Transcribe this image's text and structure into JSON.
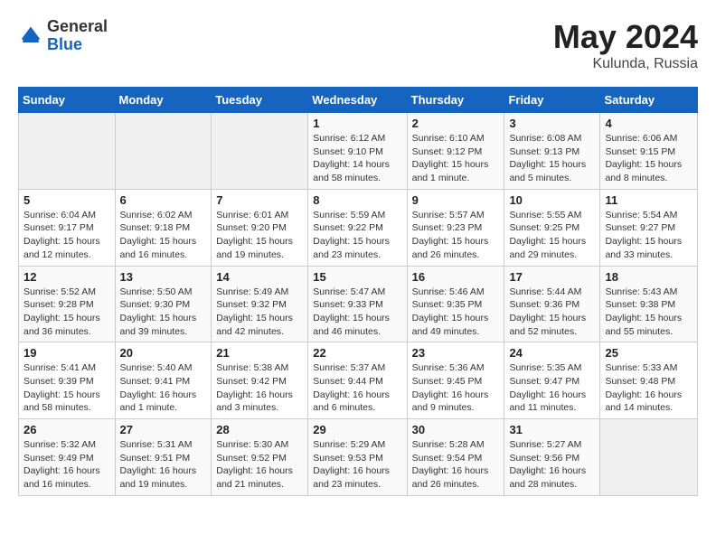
{
  "header": {
    "logo": {
      "general": "General",
      "blue": "Blue"
    },
    "title": "May 2024",
    "location": "Kulunda, Russia"
  },
  "weekdays": [
    "Sunday",
    "Monday",
    "Tuesday",
    "Wednesday",
    "Thursday",
    "Friday",
    "Saturday"
  ],
  "weeks": [
    [
      {
        "day": "",
        "info": ""
      },
      {
        "day": "",
        "info": ""
      },
      {
        "day": "",
        "info": ""
      },
      {
        "day": "1",
        "info": "Sunrise: 6:12 AM\nSunset: 9:10 PM\nDaylight: 14 hours\nand 58 minutes."
      },
      {
        "day": "2",
        "info": "Sunrise: 6:10 AM\nSunset: 9:12 PM\nDaylight: 15 hours\nand 1 minute."
      },
      {
        "day": "3",
        "info": "Sunrise: 6:08 AM\nSunset: 9:13 PM\nDaylight: 15 hours\nand 5 minutes."
      },
      {
        "day": "4",
        "info": "Sunrise: 6:06 AM\nSunset: 9:15 PM\nDaylight: 15 hours\nand 8 minutes."
      }
    ],
    [
      {
        "day": "5",
        "info": "Sunrise: 6:04 AM\nSunset: 9:17 PM\nDaylight: 15 hours\nand 12 minutes."
      },
      {
        "day": "6",
        "info": "Sunrise: 6:02 AM\nSunset: 9:18 PM\nDaylight: 15 hours\nand 16 minutes."
      },
      {
        "day": "7",
        "info": "Sunrise: 6:01 AM\nSunset: 9:20 PM\nDaylight: 15 hours\nand 19 minutes."
      },
      {
        "day": "8",
        "info": "Sunrise: 5:59 AM\nSunset: 9:22 PM\nDaylight: 15 hours\nand 23 minutes."
      },
      {
        "day": "9",
        "info": "Sunrise: 5:57 AM\nSunset: 9:23 PM\nDaylight: 15 hours\nand 26 minutes."
      },
      {
        "day": "10",
        "info": "Sunrise: 5:55 AM\nSunset: 9:25 PM\nDaylight: 15 hours\nand 29 minutes."
      },
      {
        "day": "11",
        "info": "Sunrise: 5:54 AM\nSunset: 9:27 PM\nDaylight: 15 hours\nand 33 minutes."
      }
    ],
    [
      {
        "day": "12",
        "info": "Sunrise: 5:52 AM\nSunset: 9:28 PM\nDaylight: 15 hours\nand 36 minutes."
      },
      {
        "day": "13",
        "info": "Sunrise: 5:50 AM\nSunset: 9:30 PM\nDaylight: 15 hours\nand 39 minutes."
      },
      {
        "day": "14",
        "info": "Sunrise: 5:49 AM\nSunset: 9:32 PM\nDaylight: 15 hours\nand 42 minutes."
      },
      {
        "day": "15",
        "info": "Sunrise: 5:47 AM\nSunset: 9:33 PM\nDaylight: 15 hours\nand 46 minutes."
      },
      {
        "day": "16",
        "info": "Sunrise: 5:46 AM\nSunset: 9:35 PM\nDaylight: 15 hours\nand 49 minutes."
      },
      {
        "day": "17",
        "info": "Sunrise: 5:44 AM\nSunset: 9:36 PM\nDaylight: 15 hours\nand 52 minutes."
      },
      {
        "day": "18",
        "info": "Sunrise: 5:43 AM\nSunset: 9:38 PM\nDaylight: 15 hours\nand 55 minutes."
      }
    ],
    [
      {
        "day": "19",
        "info": "Sunrise: 5:41 AM\nSunset: 9:39 PM\nDaylight: 15 hours\nand 58 minutes."
      },
      {
        "day": "20",
        "info": "Sunrise: 5:40 AM\nSunset: 9:41 PM\nDaylight: 16 hours\nand 1 minute."
      },
      {
        "day": "21",
        "info": "Sunrise: 5:38 AM\nSunset: 9:42 PM\nDaylight: 16 hours\nand 3 minutes."
      },
      {
        "day": "22",
        "info": "Sunrise: 5:37 AM\nSunset: 9:44 PM\nDaylight: 16 hours\nand 6 minutes."
      },
      {
        "day": "23",
        "info": "Sunrise: 5:36 AM\nSunset: 9:45 PM\nDaylight: 16 hours\nand 9 minutes."
      },
      {
        "day": "24",
        "info": "Sunrise: 5:35 AM\nSunset: 9:47 PM\nDaylight: 16 hours\nand 11 minutes."
      },
      {
        "day": "25",
        "info": "Sunrise: 5:33 AM\nSunset: 9:48 PM\nDaylight: 16 hours\nand 14 minutes."
      }
    ],
    [
      {
        "day": "26",
        "info": "Sunrise: 5:32 AM\nSunset: 9:49 PM\nDaylight: 16 hours\nand 16 minutes."
      },
      {
        "day": "27",
        "info": "Sunrise: 5:31 AM\nSunset: 9:51 PM\nDaylight: 16 hours\nand 19 minutes."
      },
      {
        "day": "28",
        "info": "Sunrise: 5:30 AM\nSunset: 9:52 PM\nDaylight: 16 hours\nand 21 minutes."
      },
      {
        "day": "29",
        "info": "Sunrise: 5:29 AM\nSunset: 9:53 PM\nDaylight: 16 hours\nand 23 minutes."
      },
      {
        "day": "30",
        "info": "Sunrise: 5:28 AM\nSunset: 9:54 PM\nDaylight: 16 hours\nand 26 minutes."
      },
      {
        "day": "31",
        "info": "Sunrise: 5:27 AM\nSunset: 9:56 PM\nDaylight: 16 hours\nand 28 minutes."
      },
      {
        "day": "",
        "info": ""
      }
    ]
  ]
}
